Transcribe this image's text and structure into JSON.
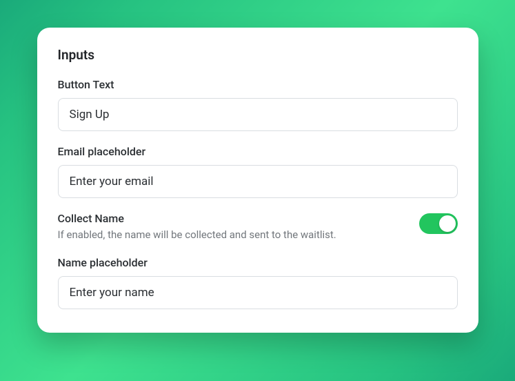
{
  "section": {
    "title": "Inputs"
  },
  "buttonText": {
    "label": "Button Text",
    "value": "Sign Up"
  },
  "emailPlaceholder": {
    "label": "Email placeholder",
    "value": "Enter your email"
  },
  "collectName": {
    "label": "Collect Name",
    "description": "If enabled, the name will be collected and sent to the waitlist.",
    "enabled": true
  },
  "namePlaceholder": {
    "label": "Name placeholder",
    "value": "Enter your name"
  }
}
